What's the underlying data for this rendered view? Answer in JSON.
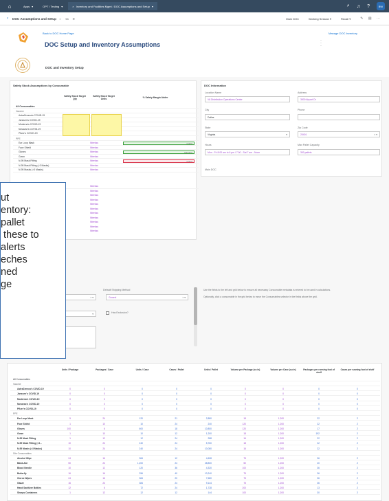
{
  "shell": {
    "tabs": [
      {
        "label": "Apps"
      },
      {
        "label": "OPT / Testing"
      },
      {
        "label": "Inventory and Facilities Mgmt / DOC Assumptions and Setup"
      }
    ],
    "avatar": "BW"
  },
  "subbar": {
    "title": "DOC Assumptions and Setup",
    "items": [
      "Main DOC",
      "Working Session",
      "Recall"
    ]
  },
  "header": {
    "back_link": "Back to DOC Home Page",
    "title": "DOC Setup and Inventory Assumptions",
    "manage_link": "Manage DOC Inventory",
    "section_title": "DOC and Inventory Setup"
  },
  "safety": {
    "title": "Safety Stock Assumptions by Consumable",
    "columns": [
      "Safety Stock Target Qty",
      "Safety Stock Target Units",
      "% Safety Margin Adder"
    ],
    "all_label": "All Consumables",
    "groups": [
      {
        "name": "Vaccine",
        "items": [
          "AstraZeneca's COVID-19",
          "Janssen's COVID-19",
          "Moderna's COVID-19",
          "Novavax's COVID-19",
          "Pfizer's COVID-19"
        ]
      },
      {
        "name": "PPE",
        "items": [
          "Ear Loop Mask",
          "Face Shield",
          "Gloves",
          "Gown",
          "N-95 Mask Fitting",
          "N-95 Mask Fitting (>3 Masks)",
          "N-95 Masks (>3 Masks)"
        ]
      }
    ],
    "unit_label": "Weekss",
    "bars": [
      {
        "value": "0.00%",
        "status": "ok"
      },
      {
        "value": "0.00%",
        "status": "ok"
      },
      {
        "value": "500.00%",
        "status": "ok"
      },
      {
        "value": "0.00%",
        "status": "error"
      }
    ]
  },
  "doc_info": {
    "title": "DOC Information",
    "location_name": {
      "label": "Location Name",
      "value": "VA Distribution Operations Center"
    },
    "address": {
      "label": "Address",
      "value": "3500 Airport Dr"
    },
    "city": {
      "label": "City",
      "value": "Dallas"
    },
    "phone": {
      "label": "Phone",
      "value": ""
    },
    "state": {
      "label": "State",
      "value": "Virginia"
    },
    "zip": {
      "label": "Zip Code",
      "value": "20401"
    },
    "hours": {
      "label": "Hours",
      "value": "Mon - Fri 8:00 am to 6 pm / 7:00 - Sat 7 am - Noon"
    },
    "max_pallet": {
      "label": "Max Pallet Capacity",
      "value": "300 pallets"
    },
    "main_doc_label": "Main DOC"
  },
  "callout": {
    "lines": [
      "ut",
      "entory:",
      "",
      "pallet",
      " these to",
      "alerts",
      "eches",
      "ned",
      "ge"
    ]
  },
  "shipping": {
    "default_label": "Default Shipping Method",
    "default_value": "Ground",
    "has_exclusion": "Has Exclusion?",
    "note1": "Use the fields to the left and grid below to ensure all necessary Consumable metadata is entered to be used in calculations.",
    "note2": "Optionally, click a consumable in the grid below to move the Consumables selector in the fields above the grid."
  },
  "bottom_table": {
    "columns": [
      "Units / Package",
      "Packages / Case",
      "Units / Case",
      "Cases / Pallet",
      "Units / Pallet",
      "Volume per Package (cu in)",
      "Volume per Case (cu in)",
      "Packages per running foot of shelf",
      "Cases per running foot of shelf"
    ],
    "all_label": "All Consumables",
    "rows": [
      {
        "label": "Vaccine",
        "group": true,
        "vals": []
      },
      {
        "label": "AstraZeneca's COVID-19",
        "vals": [
          "0",
          "0",
          "0",
          "0",
          "0",
          "0",
          "0",
          "0",
          "0"
        ]
      },
      {
        "label": "Janssen's COVID-19",
        "vals": [
          "0",
          "0",
          "0",
          "0",
          "0",
          "0",
          "0",
          "0",
          "0"
        ]
      },
      {
        "label": "Moderna's COVID-19",
        "vals": [
          "0",
          "0",
          "0",
          "0",
          "0",
          "0",
          "0",
          "0",
          "0"
        ]
      },
      {
        "label": "Novavax's COVID-19",
        "vals": [
          "0",
          "0",
          "0",
          "0",
          "0",
          "0",
          "0",
          "0",
          "0"
        ]
      },
      {
        "label": "Pfizer's COVID-19",
        "vals": [
          "0",
          "0",
          "0",
          "0",
          "0",
          "0",
          "0",
          "0",
          "0"
        ]
      },
      {
        "label": "PPE",
        "group": true,
        "vals": []
      },
      {
        "label": "Ear Loop Mask",
        "vals": [
          "5",
          "24",
          "120",
          "21",
          "2,880",
          "18",
          "1,200",
          "22",
          "2"
        ]
      },
      {
        "label": "Face Shield",
        "vals": [
          "1",
          "10",
          "10",
          "24",
          "240",
          "120",
          "1,200",
          "22",
          "2"
        ]
      },
      {
        "label": "Gloves",
        "vals": [
          "100",
          "6",
          "600",
          "18",
          "10,800",
          "120",
          "1,200",
          "17",
          "2"
        ]
      },
      {
        "label": "Gown",
        "vals": [
          "1",
          "10",
          "10",
          "12",
          "1,200",
          "18",
          "1,200",
          "192",
          "2"
        ]
      },
      {
        "label": "N-95 Mask Fitting",
        "vals": [
          "1",
          "12",
          "12",
          "24",
          "288",
          "16",
          "1,200",
          "22",
          "2"
        ]
      },
      {
        "label": "N-95 Mask Fitting (>3...",
        "vals": [
          "10",
          "24",
          "240",
          "24",
          "5,760",
          "18",
          "1,200",
          "22",
          "2"
        ]
      },
      {
        "label": "N-95 Masks (>3 Masks)",
        "vals": [
          "10",
          "24",
          "240",
          "24",
          "10,080",
          "16",
          "1,200",
          "22",
          "2"
        ]
      },
      {
        "label": "Site Consumables",
        "group": true,
        "vals": []
      },
      {
        "label": "Alcohol Wipe",
        "vals": [
          "24",
          "16",
          "384",
          "12",
          "4,608",
          "75",
          "1,200",
          "36",
          "2"
        ]
      },
      {
        "label": "Band-Aid",
        "vals": [
          "50",
          "24",
          "1,200",
          "24",
          "28,800",
          "50",
          "1,200",
          "40",
          "2"
        ]
      },
      {
        "label": "Blood Needle",
        "vals": [
          "10",
          "12",
          "120",
          "36",
          "4,320",
          "100",
          "1,200",
          "36",
          "2"
        ]
      },
      {
        "label": "Butterfly",
        "vals": [
          "16",
          "16",
          "256",
          "40",
          "10,240",
          "75",
          "1,200",
          "36",
          "2"
        ]
      },
      {
        "label": "Clorox Wipes",
        "vals": [
          "24",
          "16",
          "384",
          "20",
          "7,680",
          "75",
          "1,200",
          "36",
          "2"
        ]
      },
      {
        "label": "Gauze",
        "vals": [
          "16",
          "24",
          "384",
          "24",
          "9,144",
          "75",
          "1,200",
          "36",
          "2"
        ]
      },
      {
        "label": "Hand Sanitizer Bottles",
        "vals": [
          "12",
          "6",
          "72",
          "24",
          "1,728",
          "200",
          "1,200",
          "13",
          "2"
        ]
      },
      {
        "label": "Sharps Containers",
        "vals": [
          "1",
          "12",
          "12",
          "12",
          "144",
          "100",
          "1,200",
          "30",
          "2"
        ]
      }
    ]
  }
}
